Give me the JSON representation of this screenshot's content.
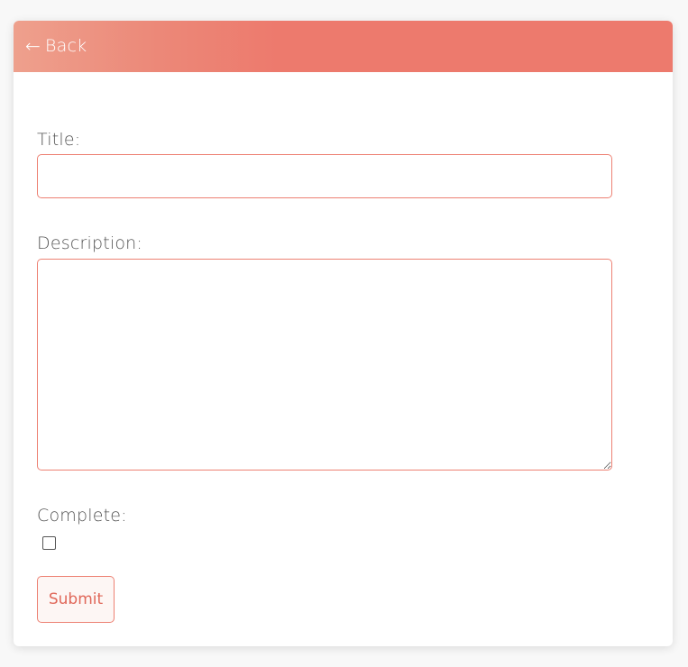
{
  "header": {
    "back_label": "Back",
    "back_arrow": "←",
    "colors": {
      "gradient_start": "#eea08d",
      "gradient_end": "#ed7a6d"
    }
  },
  "form": {
    "title_label": "Title:",
    "title_value": "",
    "description_label": "Description:",
    "description_value": "",
    "complete_label": "Complete:",
    "complete_checked": false,
    "submit_label": "Submit"
  },
  "colors": {
    "accent": "#ed8173",
    "submit_text": "#e0685a",
    "label_text": "#555555",
    "page_background": "#f8f8f8"
  },
  "icons": {
    "back": "arrow-left-icon"
  }
}
